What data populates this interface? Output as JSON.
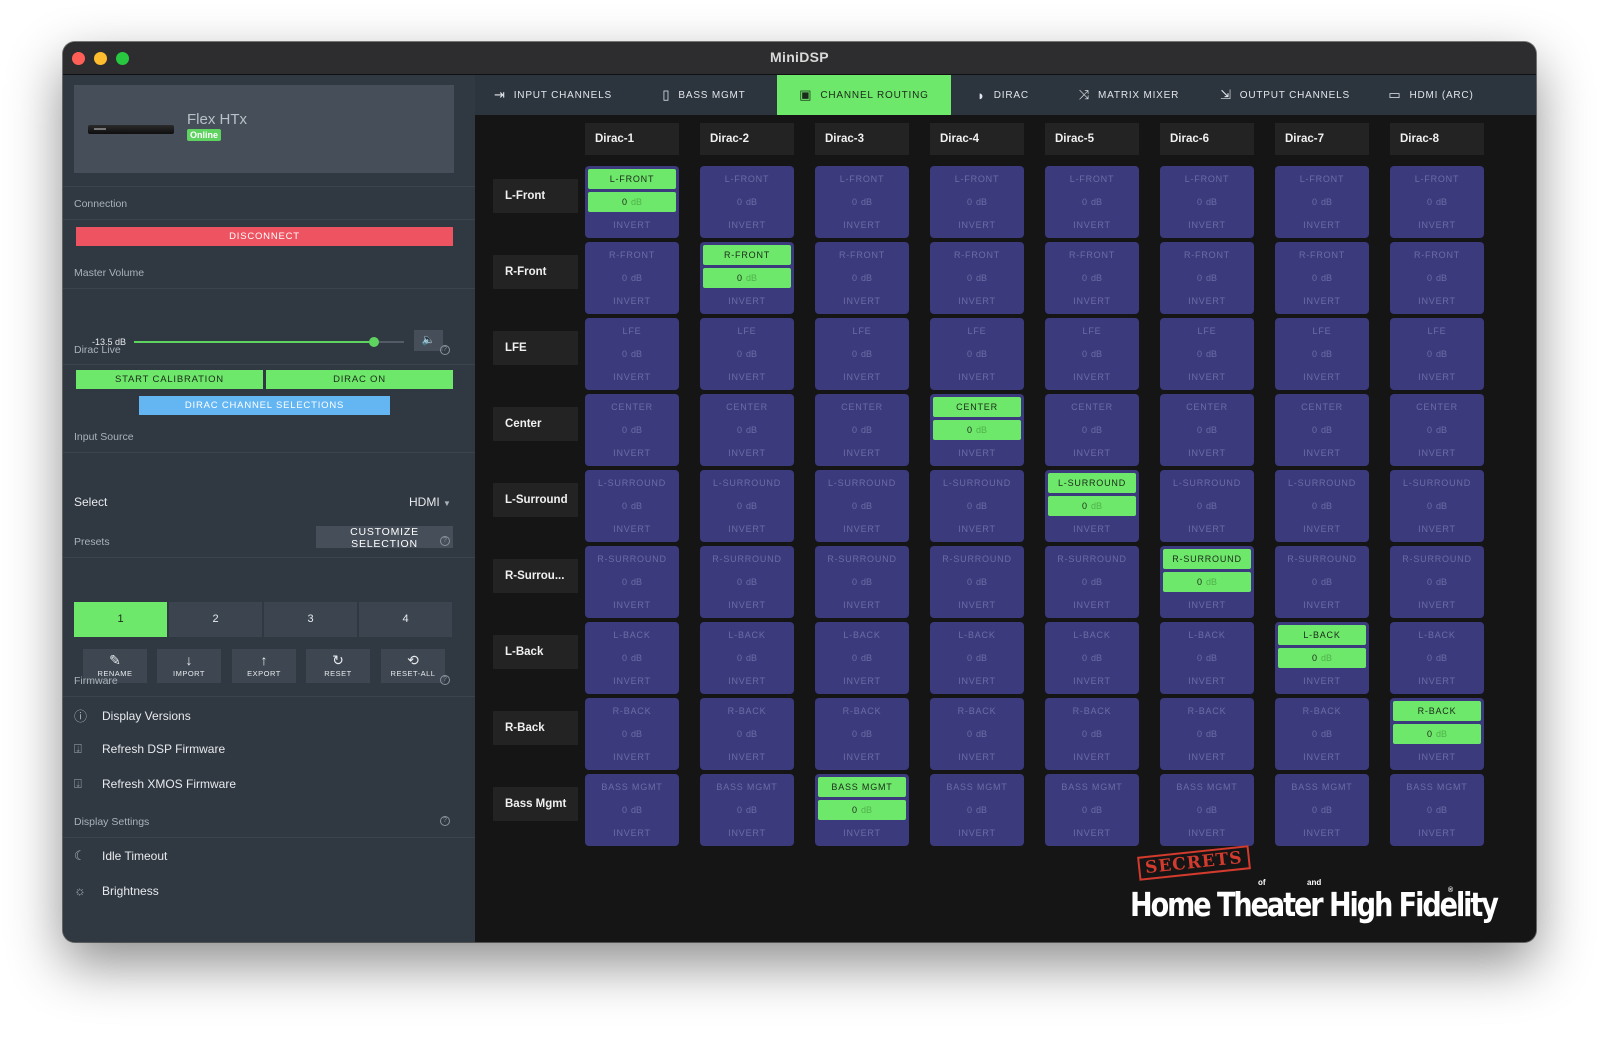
{
  "window": {
    "title": "MiniDSP"
  },
  "device": {
    "name": "Flex HTx",
    "status": "Online"
  },
  "connection": {
    "label": "Connection",
    "button": "DISCONNECT"
  },
  "master_volume": {
    "label": "Master Volume",
    "value": "-13.5 dB",
    "level_fraction": 0.89
  },
  "dirac_live": {
    "label": "Dirac Live",
    "start_calibration": "START CALIBRATION",
    "dirac_on": "DIRAC ON",
    "channel_selections": "DIRAC CHANNEL SELECTIONS"
  },
  "input_source": {
    "label": "Input Source",
    "select_label": "Select",
    "select_value": "HDMI",
    "customize": "CUSTOMIZE SELECTION"
  },
  "presets": {
    "label": "Presets",
    "items": [
      "1",
      "2",
      "3",
      "4"
    ],
    "active": "1",
    "actions": [
      {
        "label": "RENAME",
        "icon": "edit-icon"
      },
      {
        "label": "IMPORT",
        "icon": "download-arrow-icon"
      },
      {
        "label": "EXPORT",
        "icon": "upload-arrow-icon"
      },
      {
        "label": "RESET",
        "icon": "refresh-icon"
      },
      {
        "label": "RESET-ALL",
        "icon": "reset-all-icon"
      }
    ]
  },
  "firmware": {
    "label": "Firmware",
    "items": [
      {
        "label": "Display Versions",
        "icon": "info-icon"
      },
      {
        "label": "Refresh DSP Firmware",
        "icon": "upload-tray-icon"
      },
      {
        "label": "Refresh XMOS Firmware",
        "icon": "upload-tray-icon"
      }
    ]
  },
  "display_settings": {
    "label": "Display Settings",
    "items": [
      {
        "label": "Idle Timeout",
        "icon": "moon-icon"
      },
      {
        "label": "Brightness",
        "icon": "sun-icon"
      }
    ]
  },
  "tabs": [
    {
      "label": "INPUT CHANNELS",
      "icon": "input-icon"
    },
    {
      "label": "BASS MGMT",
      "icon": "speaker-icon"
    },
    {
      "label": "CHANNEL ROUTING",
      "icon": "routing-speaker-icon",
      "active": true
    },
    {
      "label": "DIRAC",
      "icon": "dirac-logo-icon"
    },
    {
      "label": "MATRIX MIXER",
      "icon": "shuffle-icon"
    },
    {
      "label": "OUTPUT CHANNELS",
      "icon": "output-icon"
    },
    {
      "label": "HDMI (ARC)",
      "icon": "hdmi-icon"
    }
  ],
  "routing": {
    "columns": [
      "Dirac-1",
      "Dirac-2",
      "Dirac-3",
      "Dirac-4",
      "Dirac-5",
      "Dirac-6",
      "Dirac-7",
      "Dirac-8"
    ],
    "rows": [
      "L-Front",
      "R-Front",
      "LFE",
      "Center",
      "L-Surround",
      "R-Surrou...",
      "L-Back",
      "R-Back",
      "Bass Mgmt"
    ],
    "channel_names": [
      "L-FRONT",
      "R-FRONT",
      "LFE",
      "CENTER",
      "L-SURROUND",
      "R-SURROUND",
      "L-BACK",
      "R-BACK",
      "BASS MGMT"
    ],
    "gain_value": "0",
    "gain_unit": "dB",
    "invert_label": "INVERT",
    "active": [
      [
        0,
        0
      ],
      [
        1,
        1
      ],
      [
        3,
        3
      ],
      [
        4,
        4
      ],
      [
        5,
        5
      ],
      [
        6,
        6
      ],
      [
        7,
        7
      ],
      [
        8,
        2
      ]
    ]
  },
  "watermark": {
    "stamp": "SECRETS",
    "of": "of",
    "and": "and",
    "main": "Home Theater High Fidelity",
    "mark": "®"
  },
  "colors": {
    "accent_green": "#6ee86a",
    "disconnect_red": "#ed5360",
    "selection_blue": "#64b6f3",
    "cell_idle": "#3b3a7c"
  }
}
